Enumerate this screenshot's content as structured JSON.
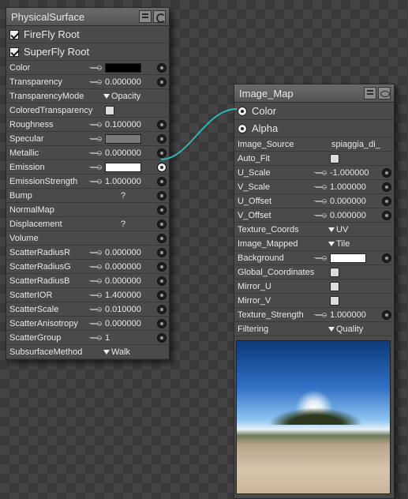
{
  "left_node": {
    "title": "PhysicalSurface",
    "checkbox_rows": [
      {
        "label": "FireFly Root",
        "checked": true
      },
      {
        "label": "SuperFly Root",
        "checked": true
      }
    ],
    "params": [
      {
        "label": "Color",
        "key": true,
        "type": "color",
        "color": "#000000",
        "socket": true
      },
      {
        "label": "Transparency",
        "key": true,
        "value": "0.000000",
        "socket": true
      },
      {
        "label": "TransparencyMode",
        "type": "dropdown",
        "value": "Opacity"
      },
      {
        "label": "ColoredTransparency",
        "type": "checkbox"
      },
      {
        "label": "Roughness",
        "key": true,
        "value": "0.100000",
        "socket": true
      },
      {
        "label": "Specular",
        "key": true,
        "type": "color",
        "color": "#7a7a7a",
        "socket": true
      },
      {
        "label": "Metallic",
        "key": true,
        "value": "0.000000",
        "socket": true
      },
      {
        "label": "Emission",
        "key": true,
        "type": "color",
        "color": "#ffffff",
        "socket": true,
        "active": true
      },
      {
        "label": "EmissionStrength",
        "key": true,
        "value": "1.000000",
        "socket": true
      },
      {
        "label": "Bump",
        "value": "?",
        "center": true,
        "socket": true
      },
      {
        "label": "NormalMap",
        "socket": true
      },
      {
        "label": "Displacement",
        "value": "?",
        "center": true,
        "socket": true
      },
      {
        "label": "Volume",
        "socket": true
      },
      {
        "label": "ScatterRadiusR",
        "key": true,
        "value": "0.000000",
        "socket": true
      },
      {
        "label": "ScatterRadiusG",
        "key": true,
        "value": "0.000000",
        "socket": true
      },
      {
        "label": "ScatterRadiusB",
        "key": true,
        "value": "0.000000",
        "socket": true
      },
      {
        "label": "ScatterIOR",
        "key": true,
        "value": "1.400000",
        "socket": true
      },
      {
        "label": "ScatterScale",
        "key": true,
        "value": "0.010000",
        "socket": true
      },
      {
        "label": "ScatterAnisotropy",
        "key": true,
        "value": "0.000000",
        "socket": true
      },
      {
        "label": "ScatterGroup",
        "key": true,
        "value": "1",
        "socket": true
      },
      {
        "label": "SubsurfaceMethod",
        "type": "dropdown",
        "value": "Walk"
      }
    ]
  },
  "right_node": {
    "title": "Image_Map",
    "outputs": [
      {
        "label": "Color"
      },
      {
        "label": "Alpha"
      }
    ],
    "params": [
      {
        "label": "Image_Source",
        "value": "spiaggia_di_"
      },
      {
        "label": "Auto_Fit",
        "type": "checkbox"
      },
      {
        "label": "U_Scale",
        "key": true,
        "value": "-1.000000",
        "socket": true
      },
      {
        "label": "V_Scale",
        "key": true,
        "value": "1.000000",
        "socket": true
      },
      {
        "label": "U_Offset",
        "key": true,
        "value": "0.000000",
        "socket": true
      },
      {
        "label": "V_Offset",
        "key": true,
        "value": "0.000000",
        "socket": true
      },
      {
        "label": "Texture_Coords",
        "type": "dropdown",
        "value": "UV"
      },
      {
        "label": "Image_Mapped",
        "type": "dropdown",
        "value": "Tile"
      },
      {
        "label": "Background",
        "key": true,
        "type": "color",
        "color": "#ffffff",
        "socket": true
      },
      {
        "label": "Global_Coordinates",
        "type": "checkbox"
      },
      {
        "label": "Mirror_U",
        "type": "checkbox"
      },
      {
        "label": "Mirror_V",
        "type": "checkbox"
      },
      {
        "label": "Texture_Strength",
        "key": true,
        "value": "1.000000",
        "socket": true
      },
      {
        "label": "Filtering",
        "type": "dropdown",
        "value": "Quality"
      }
    ]
  },
  "wire_color": "#2fb5b5"
}
